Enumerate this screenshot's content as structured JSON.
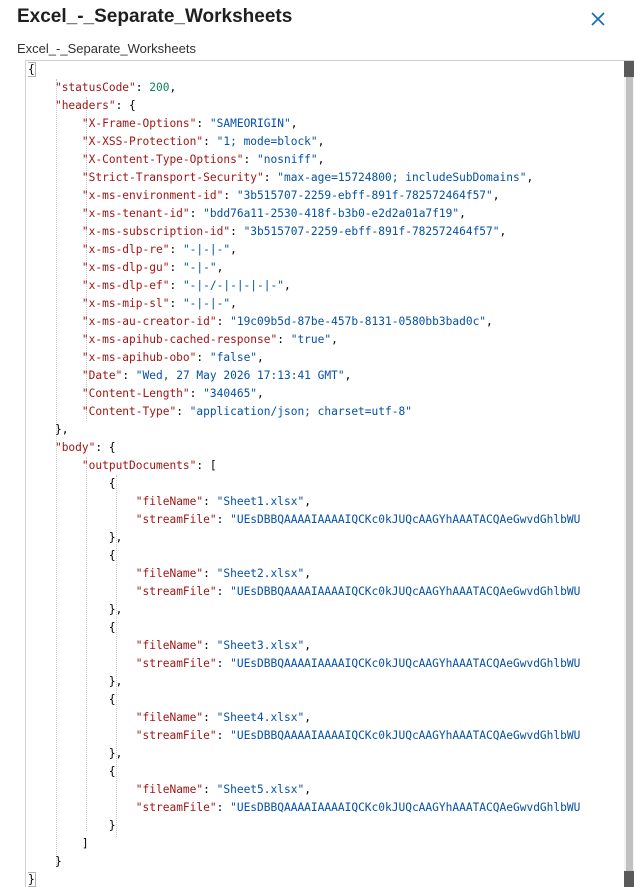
{
  "panel": {
    "title": "Excel_-_Separate_Worksheets",
    "subtitle": "Excel_-_Separate_Worksheets",
    "close_icon": "close-icon"
  },
  "json": {
    "statusCode_key": "\"statusCode\"",
    "statusCode_val": "200",
    "headers_key": "\"headers\"",
    "headers": [
      {
        "k": "\"X-Frame-Options\"",
        "v": "\"SAMEORIGIN\""
      },
      {
        "k": "\"X-XSS-Protection\"",
        "v": "\"1; mode=block\""
      },
      {
        "k": "\"X-Content-Type-Options\"",
        "v": "\"nosniff\""
      },
      {
        "k": "\"Strict-Transport-Security\"",
        "v": "\"max-age=15724800; includeSubDomains\""
      },
      {
        "k": "\"x-ms-environment-id\"",
        "v": "\"3b515707-2259-ebff-891f-782572464f57\""
      },
      {
        "k": "\"x-ms-tenant-id\"",
        "v": "\"bdd76a11-2530-418f-b3b0-e2d2a01a7f19\""
      },
      {
        "k": "\"x-ms-subscription-id\"",
        "v": "\"3b515707-2259-ebff-891f-782572464f57\""
      },
      {
        "k": "\"x-ms-dlp-re\"",
        "v": "\"-|-|-\""
      },
      {
        "k": "\"x-ms-dlp-gu\"",
        "v": "\"-|-\""
      },
      {
        "k": "\"x-ms-dlp-ef\"",
        "v": "\"-|-/-|-|-|-|-\""
      },
      {
        "k": "\"x-ms-mip-sl\"",
        "v": "\"-|-|-\""
      },
      {
        "k": "\"x-ms-au-creator-id\"",
        "v": "\"19c09b5d-87be-457b-8131-0580bb3bad0c\""
      },
      {
        "k": "\"x-ms-apihub-cached-response\"",
        "v": "\"true\""
      },
      {
        "k": "\"x-ms-apihub-obo\"",
        "v": "\"false\""
      },
      {
        "k": "\"Date\"",
        "v": "\"Wed, 27 May 2026 17:13:41 GMT\""
      },
      {
        "k": "\"Content-Length\"",
        "v": "\"340465\""
      },
      {
        "k": "\"Content-Type\"",
        "v": "\"application/json; charset=utf-8\""
      }
    ],
    "body_key": "\"body\"",
    "outputDocuments_key": "\"outputDocuments\"",
    "fileName_key": "\"fileName\"",
    "streamFile_key": "\"streamFile\"",
    "documents": [
      {
        "fileName": "\"Sheet1.xlsx\"",
        "streamFile": "\"UEsDBBQAAAAIAAAAIQCKc0kJUQcAAGYhAAATACQAeGwvdGhlbWU"
      },
      {
        "fileName": "\"Sheet2.xlsx\"",
        "streamFile": "\"UEsDBBQAAAAIAAAAIQCKc0kJUQcAAGYhAAATACQAeGwvdGhlbWU"
      },
      {
        "fileName": "\"Sheet3.xlsx\"",
        "streamFile": "\"UEsDBBQAAAAIAAAAIQCKc0kJUQcAAGYhAAATACQAeGwvdGhlbWU"
      },
      {
        "fileName": "\"Sheet4.xlsx\"",
        "streamFile": "\"UEsDBBQAAAAIAAAAIQCKc0kJUQcAAGYhAAATACQAeGwvdGhlbWU"
      },
      {
        "fileName": "\"Sheet5.xlsx\"",
        "streamFile": "\"UEsDBBQAAAAIAAAAIQCKc0kJUQcAAGYhAAATACQAeGwvdGhlbWU"
      }
    ]
  }
}
